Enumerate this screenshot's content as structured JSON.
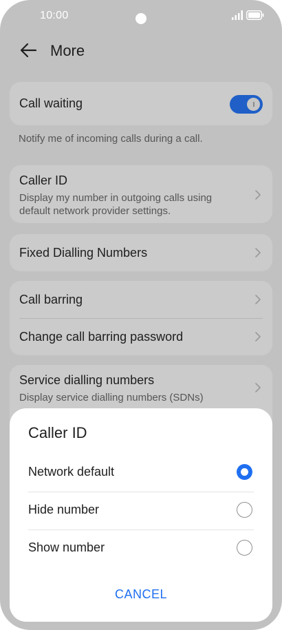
{
  "status_bar": {
    "time": "10:00"
  },
  "header": {
    "title": "More"
  },
  "call_waiting": {
    "label": "Call waiting",
    "enabled": true,
    "note": "Notify me of incoming calls during a call."
  },
  "caller_id": {
    "label": "Caller ID",
    "subtitle_line1": "Display my number in outgoing calls using",
    "subtitle_line2": "default network provider settings."
  },
  "fixed_dialling": {
    "label": "Fixed Dialling Numbers"
  },
  "call_barring": {
    "label": "Call barring",
    "change_password_label": "Change call barring password"
  },
  "service_dialling": {
    "label": "Service dialling numbers",
    "subtitle": "Display service dialling numbers (SDNs)"
  },
  "dialog": {
    "title": "Caller ID",
    "options": [
      {
        "label": "Network default",
        "selected": true
      },
      {
        "label": "Hide number",
        "selected": false
      },
      {
        "label": "Show number",
        "selected": false
      }
    ],
    "cancel_label": "CANCEL"
  },
  "colors": {
    "accent": "#1f6ff0",
    "toggle": "#1f5fc7",
    "scrim_background": "#c1c1c1",
    "card_background": "#cbcbcb"
  }
}
